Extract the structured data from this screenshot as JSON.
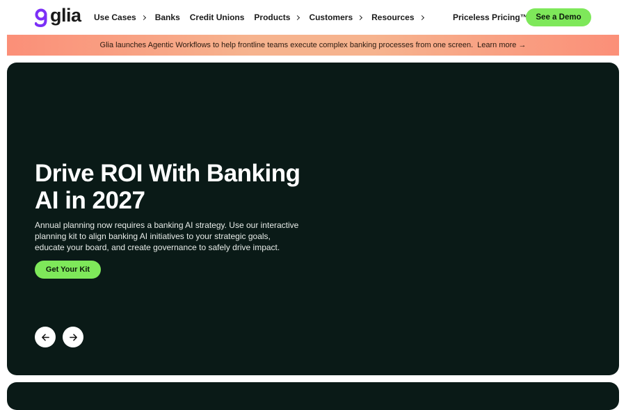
{
  "brand": {
    "name": "glia",
    "accent": "#7ee85a",
    "logo_color": "#7b2ff7"
  },
  "nav": {
    "items": [
      {
        "label": "Use Cases",
        "has_chevron": true
      },
      {
        "label": "Banks",
        "has_chevron": false
      },
      {
        "label": "Credit Unions",
        "has_chevron": false
      },
      {
        "label": "Products",
        "has_chevron": true
      },
      {
        "label": "Customers",
        "has_chevron": true
      },
      {
        "label": "Resources",
        "has_chevron": true
      }
    ],
    "pricing_label": "Priceless Pricing™",
    "demo_label": "See a Demo"
  },
  "banner": {
    "text": "Glia launches Agentic Workflows to help frontline teams execute complex banking processes from one screen.",
    "link_label": "Learn more →"
  },
  "hero": {
    "title": "Drive ROI With Banking AI in 2027",
    "description": "Annual planning now requires a banking AI strategy. Use our interactive planning kit to align banking AI initiatives to your strategic goals, educate your board, and create governance to safely drive impact.",
    "cta_label": "Get Your Kit",
    "prev_icon": "arrow-left-icon",
    "next_icon": "arrow-right-icon"
  }
}
